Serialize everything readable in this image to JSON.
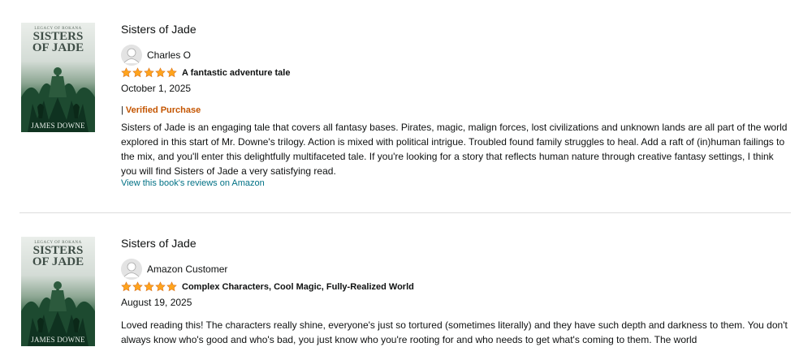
{
  "reviews": [
    {
      "book_title": "Sisters of Jade",
      "cover": {
        "series": "LEGACY OF ROKANA",
        "title": "SISTERS\nOF JADE",
        "author": "JAMES DOWNE"
      },
      "reviewer": "Charles O",
      "avatar_icon": "user-silhouette-icon",
      "rating": 5,
      "rating_max": 5,
      "headline": "A fantastic adventure tale",
      "date": "October 1, 2025",
      "verified_separator": "|",
      "verified_label": "Verified Purchase",
      "body": "Sisters of Jade is an engaging tale that covers all fantasy bases. Pirates, magic, malign forces, lost civilizations and unknown lands are all part of the world explored in this start of Mr. Downe's trilogy. Action is mixed with political intrigue. Troubled found family struggles to heal. Add a raft of (in)human failings to the mix, and you'll enter this delightfully multifaceted tale. If you're looking for a story that reflects human nature through creative fantasy settings, I think you will find Sisters of Jade a very satisfying read.",
      "link": "View this book's reviews on Amazon"
    },
    {
      "book_title": "Sisters of Jade",
      "cover": {
        "series": "LEGACY OF ROKANA",
        "title": "SISTERS\nOF JADE",
        "author": "JAMES DOWNE"
      },
      "reviewer": "Amazon Customer",
      "avatar_icon": "user-silhouette-icon",
      "rating": 5,
      "rating_max": 5,
      "headline": "Complex Characters, Cool Magic, Fully-Realized World",
      "date": "August 19, 2025",
      "body": "Loved reading this! The characters really shine, everyone's just so tortured (sometimes literally) and they have such depth and darkness to them. You don't always know who's good and who's bad, you just know who you're rooting for and who needs to get what's coming to them. The world"
    }
  ],
  "colors": {
    "star": "#ffa41c",
    "star_outline": "#de7921",
    "verified": "#c45500",
    "link": "#007185",
    "divider": "#dddddd"
  }
}
